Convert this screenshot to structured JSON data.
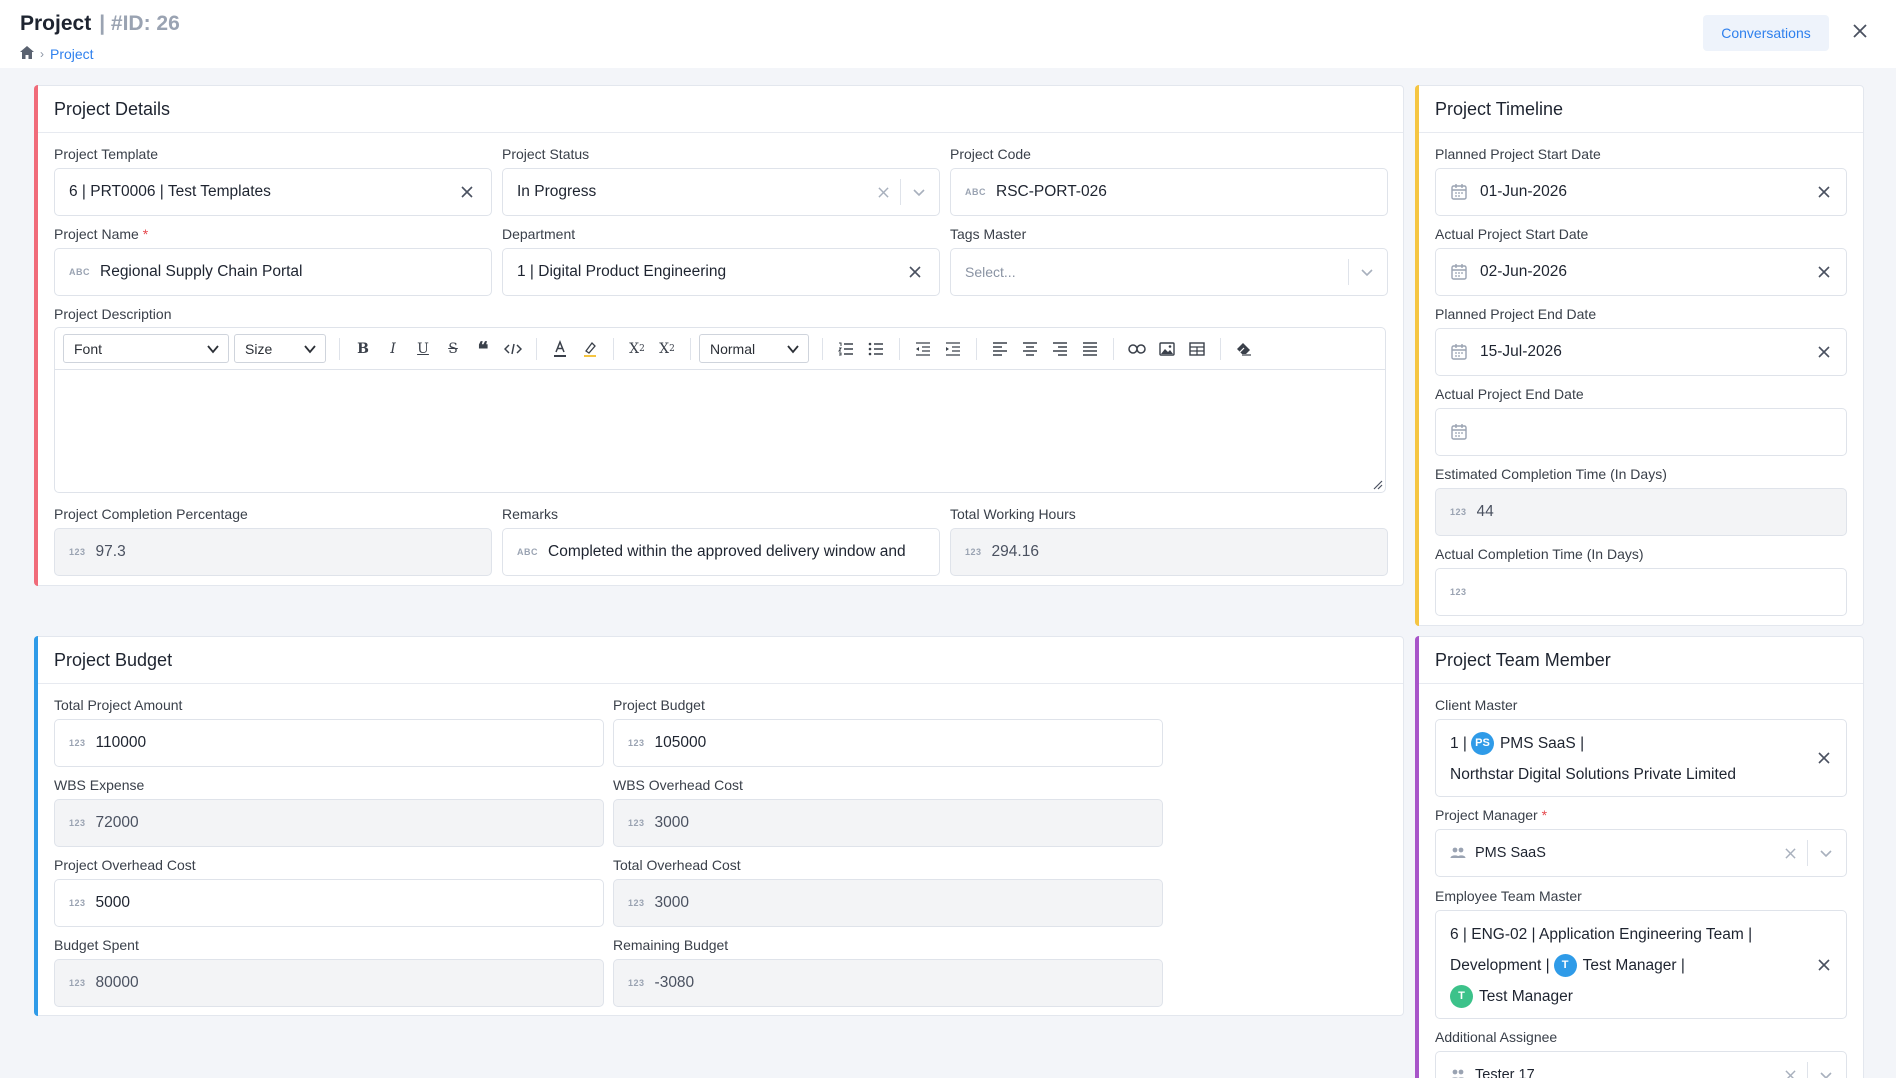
{
  "header": {
    "title": "Project",
    "id_label": "| #ID: 26",
    "breadcrumb_current": "Project",
    "conversations_label": "Conversations"
  },
  "details": {
    "title": "Project Details",
    "template_label": "Project Template",
    "template_value": "6 |  PRT0006 |  Test Templates",
    "status_label": "Project Status",
    "status_value": "In Progress",
    "code_label": "Project Code",
    "code_value": "RSC-PORT-026",
    "name_label": "Project Name",
    "name_value": "Regional Supply Chain Portal",
    "department_label": "Department",
    "department_value": "1 |  Digital Product Engineering",
    "tags_label": "Tags Master",
    "tags_placeholder": "Select...",
    "description_label": "Project Description",
    "editor": {
      "font": "Font",
      "size": "Size",
      "heading": "Normal"
    },
    "completion_label": "Project Completion Percentage",
    "completion_value": "97.3",
    "remarks_label": "Remarks",
    "remarks_value": "Completed within the approved delivery window and",
    "hours_label": "Total Working Hours",
    "hours_value": "294.16"
  },
  "timeline": {
    "title": "Project Timeline",
    "planned_start_label": "Planned Project Start Date",
    "planned_start_value": "01-Jun-2026",
    "actual_start_label": "Actual Project Start Date",
    "actual_start_value": "02-Jun-2026",
    "planned_end_label": "Planned Project End Date",
    "planned_end_value": "15-Jul-2026",
    "actual_end_label": "Actual Project End Date",
    "est_label": "Estimated Completion Time (In Days)",
    "est_value": "44",
    "act_label": "Actual Completion Time (In Days)"
  },
  "budget": {
    "title": "Project Budget",
    "total_amount_label": "Total Project Amount",
    "total_amount_value": "110000",
    "project_budget_label": "Project Budget",
    "project_budget_value": "105000",
    "wbs_expense_label": "WBS Expense",
    "wbs_expense_value": "72000",
    "wbs_overhead_label": "WBS Overhead Cost",
    "wbs_overhead_value": "3000",
    "project_overhead_label": "Project Overhead Cost",
    "project_overhead_value": "5000",
    "total_overhead_label": "Total Overhead Cost",
    "total_overhead_value": "3000",
    "spent_label": "Budget Spent",
    "spent_value": "80000",
    "remaining_label": "Remaining Budget",
    "remaining_value": "-3080"
  },
  "team": {
    "title": "Project Team Member",
    "client_label": "Client Master",
    "client_prefix": "1 |",
    "client_chip": "PS",
    "client_name": "PMS SaaS |",
    "client_company": "Northstar Digital Solutions Private Limited",
    "manager_label": "Project Manager",
    "manager_value": "PMS SaaS",
    "employee_team_label": "Employee Team Master",
    "employee_team_line1": "6 |  ENG-02 |  Application Engineering Team |",
    "employee_team_line2a": "Development |",
    "employee_team_chip1": "T",
    "employee_team_line2b": "Test Manager |",
    "employee_team_chip2": "T",
    "employee_team_line3": "Test Manager",
    "assignee_label": "Additional Assignee",
    "assignee_value": "Tester 17"
  },
  "icon_text": {
    "abc": "ABC",
    "num": "123",
    "required": "*"
  },
  "colors": {
    "details_accent": "#f06b7a",
    "timeline_accent": "#f5c542",
    "budget_accent": "#2f9be8",
    "team_accent": "#a855c9",
    "link_blue": "#2f80ed",
    "chip_blue": "#2f9be8",
    "chip_green": "#3cc28a"
  }
}
